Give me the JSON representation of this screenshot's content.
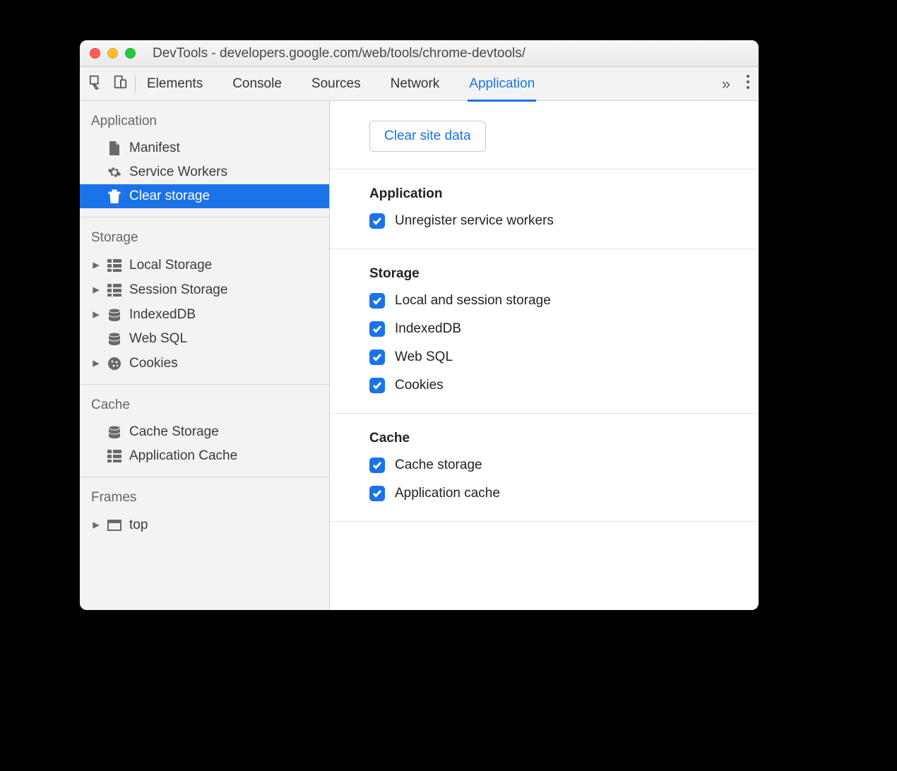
{
  "window": {
    "title": "DevTools - developers.google.com/web/tools/chrome-devtools/"
  },
  "toolbar": {
    "tabs": [
      "Elements",
      "Console",
      "Sources",
      "Network",
      "Application"
    ],
    "active_tab": "Application"
  },
  "sidebar": {
    "groups": [
      {
        "title": "Application",
        "items": [
          {
            "label": "Manifest",
            "icon": "file",
            "expandable": false,
            "selected": false
          },
          {
            "label": "Service Workers",
            "icon": "gear",
            "expandable": false,
            "selected": false
          },
          {
            "label": "Clear storage",
            "icon": "trash",
            "expandable": false,
            "selected": true
          }
        ]
      },
      {
        "title": "Storage",
        "items": [
          {
            "label": "Local Storage",
            "icon": "grid",
            "expandable": true,
            "selected": false
          },
          {
            "label": "Session Storage",
            "icon": "grid",
            "expandable": true,
            "selected": false
          },
          {
            "label": "IndexedDB",
            "icon": "db",
            "expandable": true,
            "selected": false
          },
          {
            "label": "Web SQL",
            "icon": "db",
            "expandable": false,
            "selected": false
          },
          {
            "label": "Cookies",
            "icon": "cookie",
            "expandable": true,
            "selected": false
          }
        ]
      },
      {
        "title": "Cache",
        "items": [
          {
            "label": "Cache Storage",
            "icon": "db",
            "expandable": false,
            "selected": false
          },
          {
            "label": "Application Cache",
            "icon": "grid",
            "expandable": false,
            "selected": false
          }
        ]
      },
      {
        "title": "Frames",
        "items": [
          {
            "label": "top",
            "icon": "frame",
            "expandable": true,
            "selected": false
          }
        ]
      }
    ]
  },
  "content": {
    "clear_button": "Clear site data",
    "sections": [
      {
        "title": "Application",
        "options": [
          {
            "label": "Unregister service workers",
            "checked": true
          }
        ]
      },
      {
        "title": "Storage",
        "options": [
          {
            "label": "Local and session storage",
            "checked": true
          },
          {
            "label": "IndexedDB",
            "checked": true
          },
          {
            "label": "Web SQL",
            "checked": true
          },
          {
            "label": "Cookies",
            "checked": true
          }
        ]
      },
      {
        "title": "Cache",
        "options": [
          {
            "label": "Cache storage",
            "checked": true
          },
          {
            "label": "Application cache",
            "checked": true
          }
        ]
      }
    ]
  }
}
